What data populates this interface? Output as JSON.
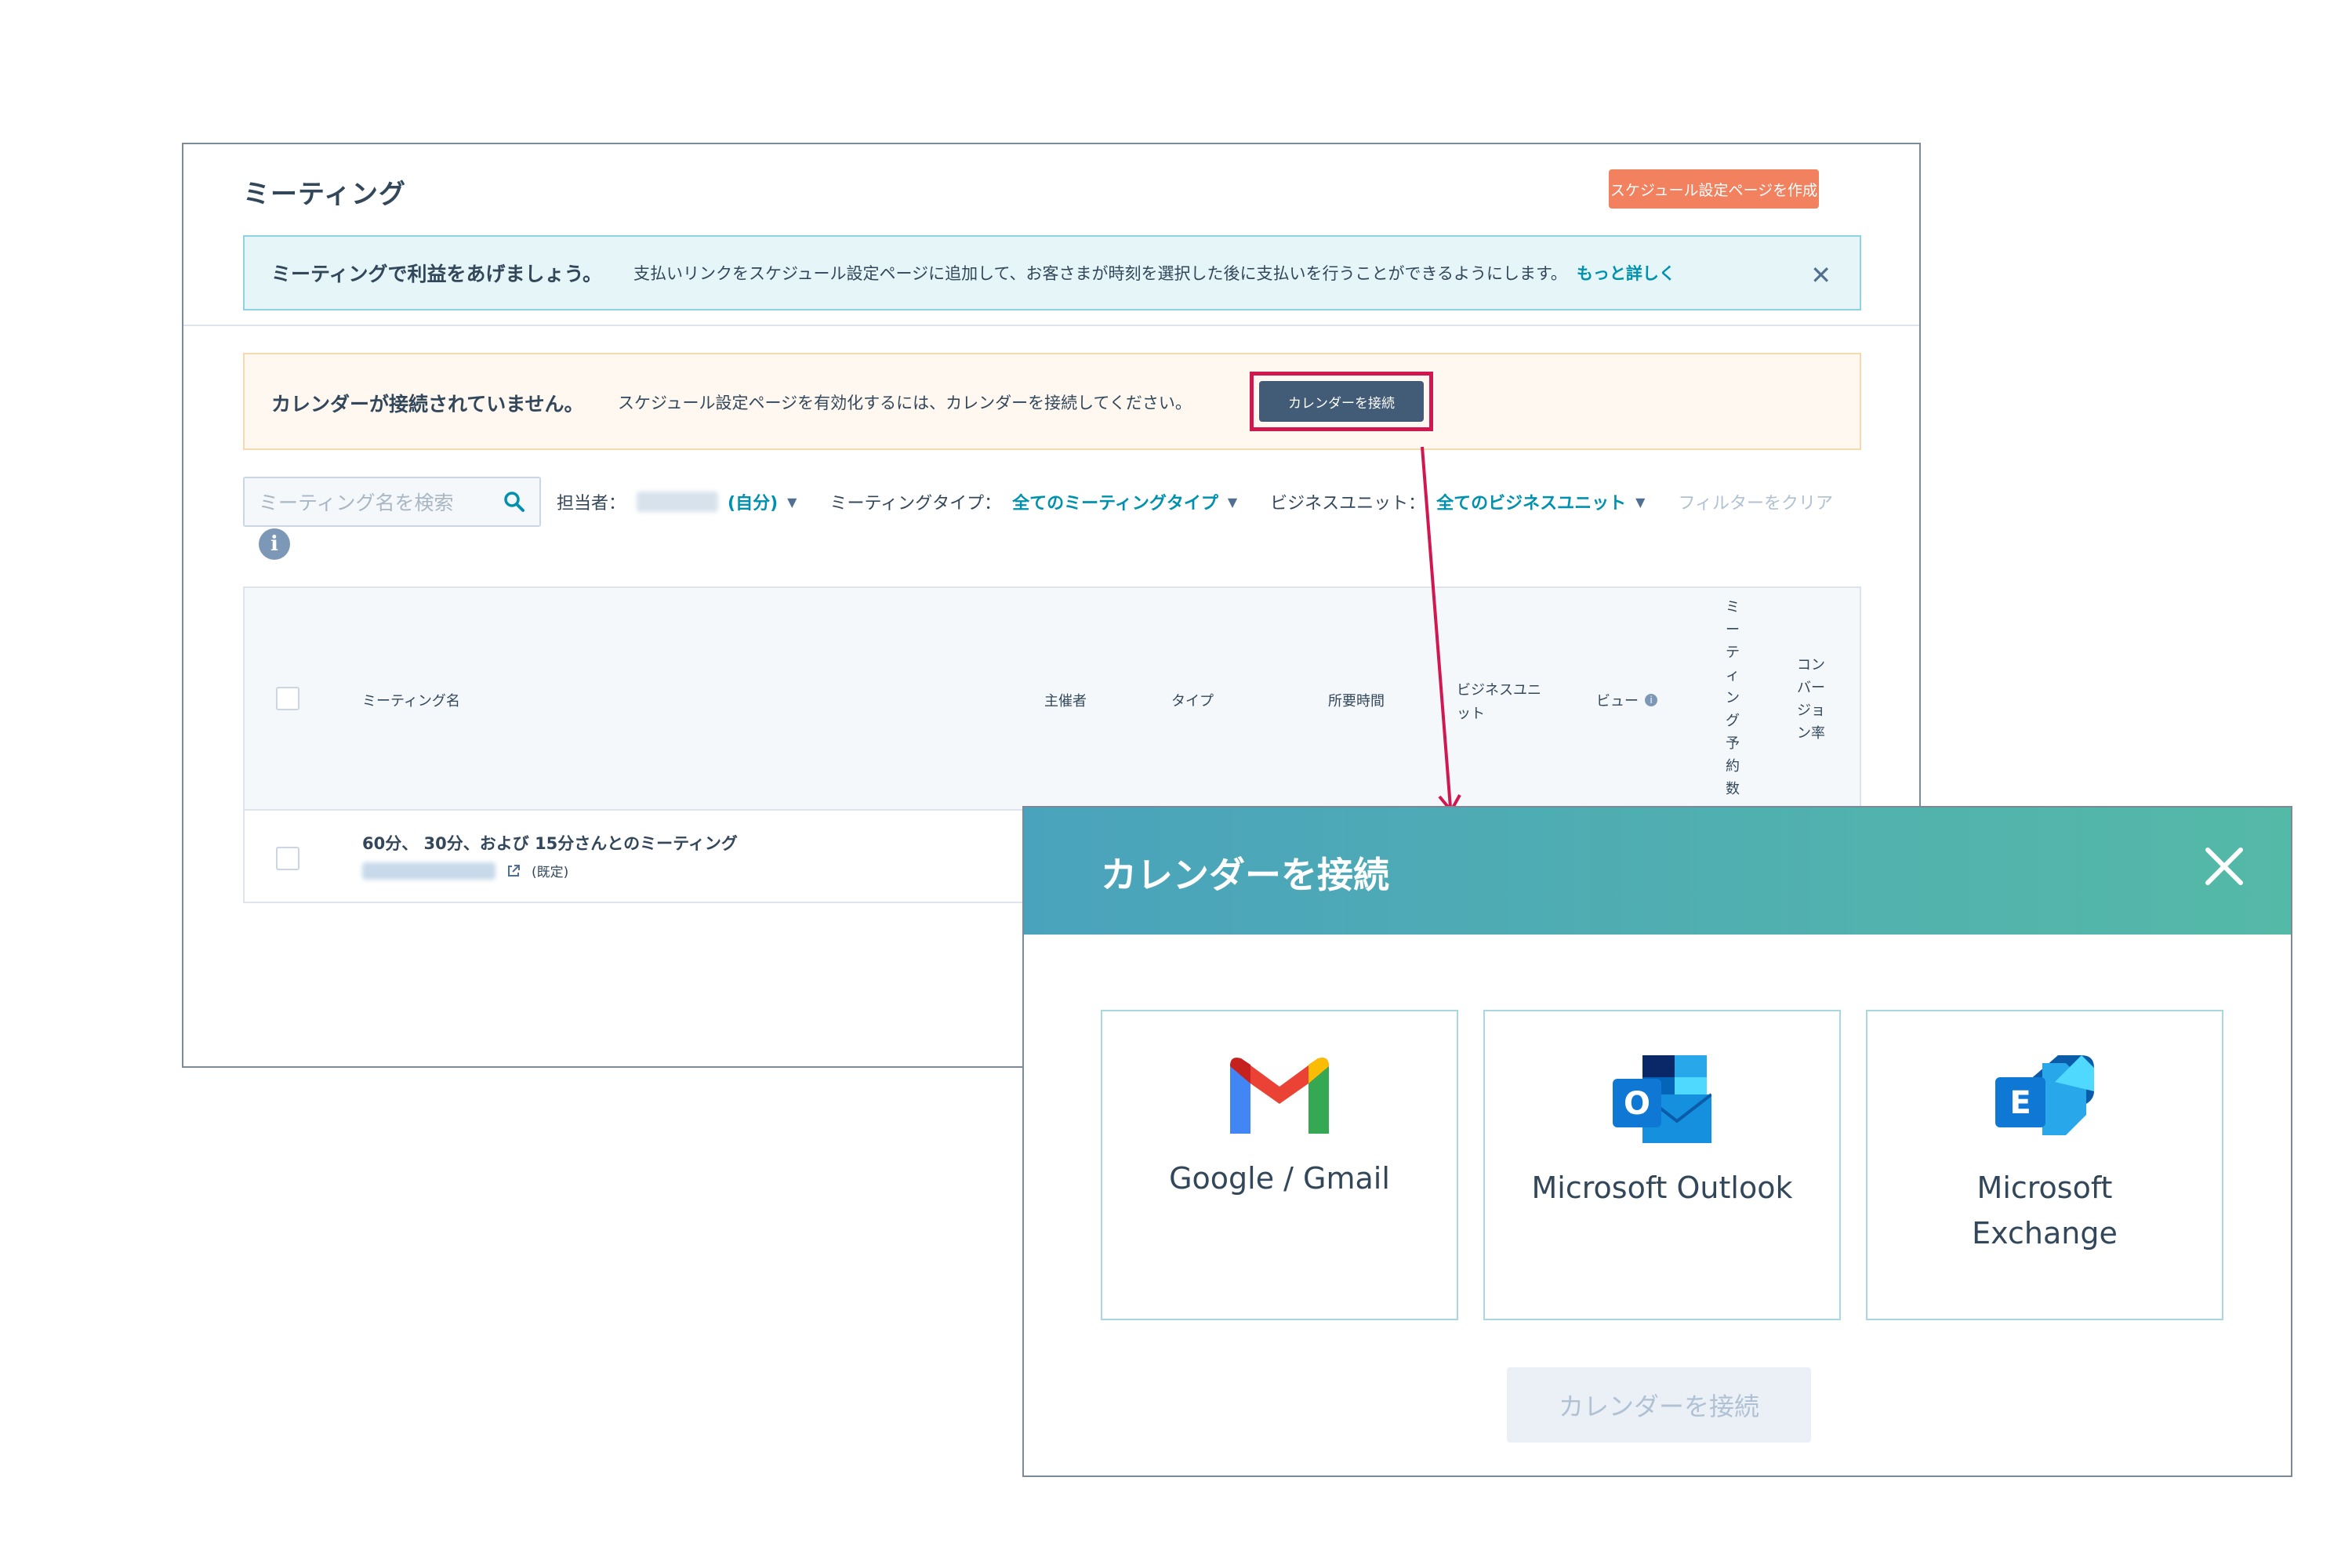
{
  "meetings": {
    "title": "ミーティング",
    "create_button": "スケジュール設定ページを作成",
    "promo": {
      "title": "ミーティングで利益をあげましょう。",
      "message": "支払いリンクをスケジュール設定ページに追加して、お客さまが時刻を選択した後に支払いを行うことができるようにします。",
      "link": "もっと詳しく"
    },
    "warning": {
      "title": "カレンダーが接続されていません。",
      "message": "スケジュール設定ページを有効化するには、カレンダーを接続してください。",
      "button": "カレンダーを接続"
    },
    "search": {
      "placeholder": "ミーティング名を検索"
    },
    "filters": {
      "owner_label": "担当者：",
      "owner_value": "(自分)",
      "type_label": "ミーティングタイプ：",
      "type_value": "全てのミーティングタイプ",
      "unit_label": "ビジネスユニット：",
      "unit_value": "全てのビジネスユニット",
      "clear": "フィルターをクリア"
    },
    "table": {
      "columns": {
        "name": "ミーティング名",
        "host": "主催者",
        "type": "タイプ",
        "duration": "所要時間",
        "business_unit": "ビジネスユニット",
        "view": "ビュー",
        "bookings": "ミーティング予約数",
        "conversion": "コンバージョン率"
      },
      "rows": [
        {
          "name": "60分、 30分、および 15分さんとのミーティング",
          "tag": "(既定)"
        }
      ]
    }
  },
  "modal": {
    "title": "カレンダーを接続",
    "options": [
      {
        "label": "Google / Gmail",
        "icon": "gmail-icon"
      },
      {
        "label": "Microsoft Outlook",
        "icon": "outlook-icon"
      },
      {
        "label": "Microsoft\nExchange",
        "icon": "exchange-icon"
      }
    ],
    "connect_button": "カレンダーを接続"
  },
  "colors": {
    "primary_orange": "#f2815f",
    "link": "#0091ae",
    "highlight": "#d0174f",
    "dark_button": "#425b76",
    "modal_gradient_start": "#4aa3bc",
    "modal_gradient_end": "#55b9a7"
  }
}
